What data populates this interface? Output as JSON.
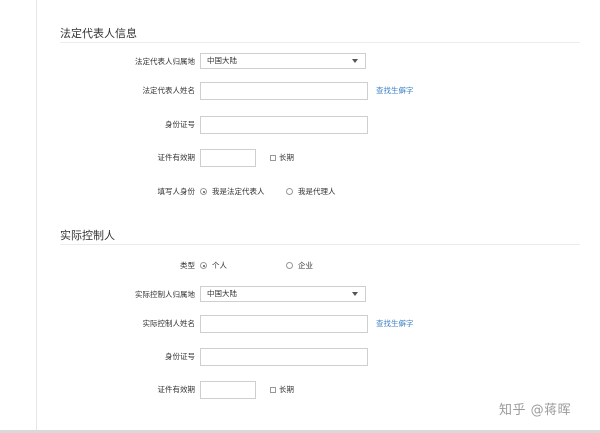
{
  "legal_rep": {
    "title": "法定代表人信息",
    "region_label": "法定代表人归属地",
    "region_value": "中国大陆",
    "name_label": "法定代表人姓名",
    "find_rare_chars": "查找生僻字",
    "id_label": "身份证号",
    "validity_label": "证件有效期",
    "long_term_label": "长期",
    "filler_label": "填写人身份",
    "filler_options": [
      "我是法定代表人",
      "我是代理人"
    ],
    "filler_selected": 0
  },
  "controller": {
    "title": "实际控制人",
    "type_label": "类型",
    "type_options": [
      "个人",
      "企业"
    ],
    "type_selected": 0,
    "region_label": "实际控制人归属地",
    "region_value": "中国大陆",
    "name_label": "实际控制人姓名",
    "find_rare_chars": "查找生僻字",
    "id_label": "身份证号",
    "validity_label": "证件有效期",
    "long_term_label": "长期"
  },
  "watermark": "知乎 @蒋晖"
}
